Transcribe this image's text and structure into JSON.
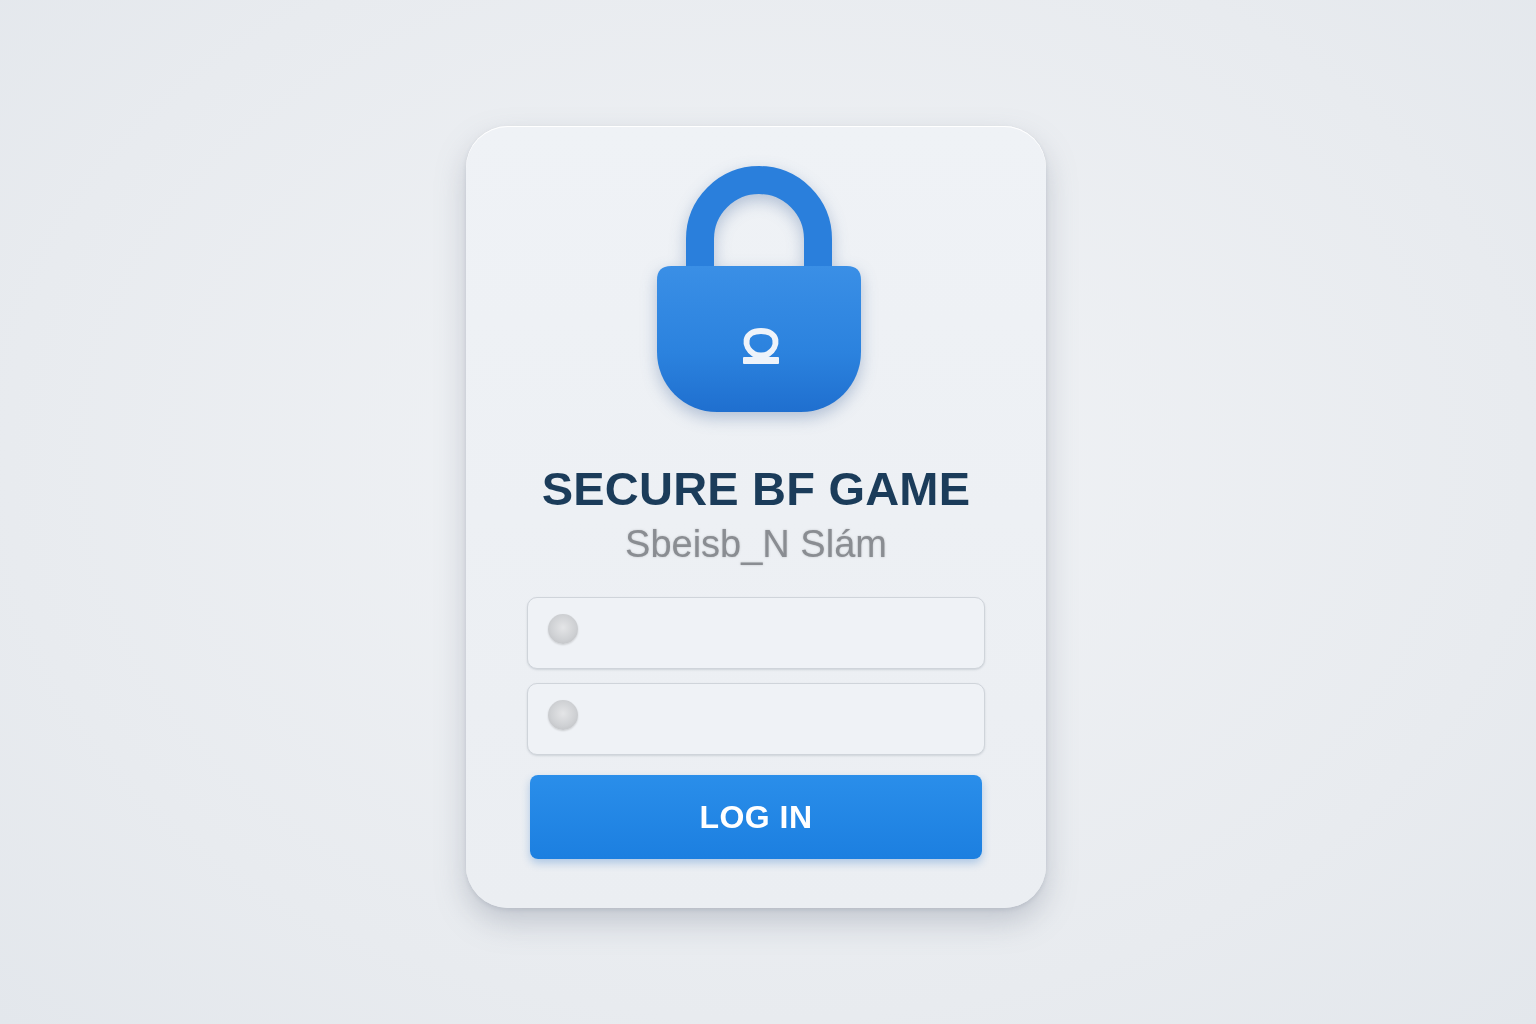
{
  "card": {
    "title": "SECURE BF GAME",
    "subtitle": "Sbeisb_N Slám",
    "fields": [
      {
        "kind": "input",
        "icon": true
      },
      {
        "kind": "input",
        "icon": true
      }
    ],
    "button": {
      "label": "LOG IN"
    }
  }
}
